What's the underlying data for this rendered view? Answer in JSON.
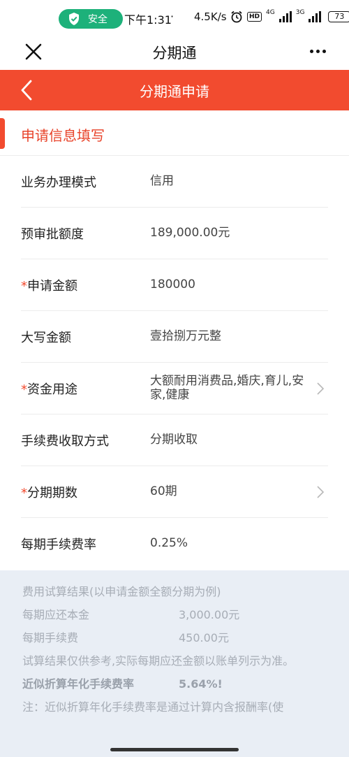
{
  "status_bar": {
    "safe_label": "安全",
    "time": "下午1:31",
    "dot": "·",
    "speed": "4.5K/s",
    "hd": "HD",
    "net1": "4G",
    "net2": "3G",
    "battery": "73"
  },
  "title_bar": {
    "title": "分期通"
  },
  "header": {
    "title": "分期通申请",
    "accent_color": "#f24b2f"
  },
  "section": {
    "title": "申请信息填写"
  },
  "form": {
    "rows": [
      {
        "label": "业务办理模式",
        "required": false,
        "value": "信用",
        "has_chevron": false
      },
      {
        "label": "预审批额度",
        "required": false,
        "value": "189,000.00元",
        "has_chevron": false
      },
      {
        "label": "申请金额",
        "required": true,
        "value": "180000",
        "has_chevron": false
      },
      {
        "label": "大写金额",
        "required": false,
        "value": "壹拾捌万元整",
        "has_chevron": false
      },
      {
        "label": "资金用途",
        "required": true,
        "value": "大额耐用消费品,婚庆,育儿,安家,健康",
        "has_chevron": true
      },
      {
        "label": "手续费收取方式",
        "required": false,
        "value": "分期收取",
        "has_chevron": false
      },
      {
        "label": "分期期数",
        "required": true,
        "value": "60期",
        "has_chevron": true
      },
      {
        "label": "每期手续费率",
        "required": false,
        "value": "0.25%",
        "has_chevron": false
      }
    ],
    "required_mark": "*"
  },
  "calc": {
    "title": "费用试算结果(以申请金额全额分期为例)",
    "principal_label": "每期应还本金",
    "principal_value": "3,000.00元",
    "fee_label": "每期手续费",
    "fee_value": "450.00元",
    "disclaimer": "试算结果仅供参考,实际每期应还金额以账单列示为准。",
    "annual_label": "近似折算年化手续费率",
    "annual_value": "5.64%!",
    "note": "注：近似折算年化手续费率是通过计算内含报酬率(使"
  }
}
